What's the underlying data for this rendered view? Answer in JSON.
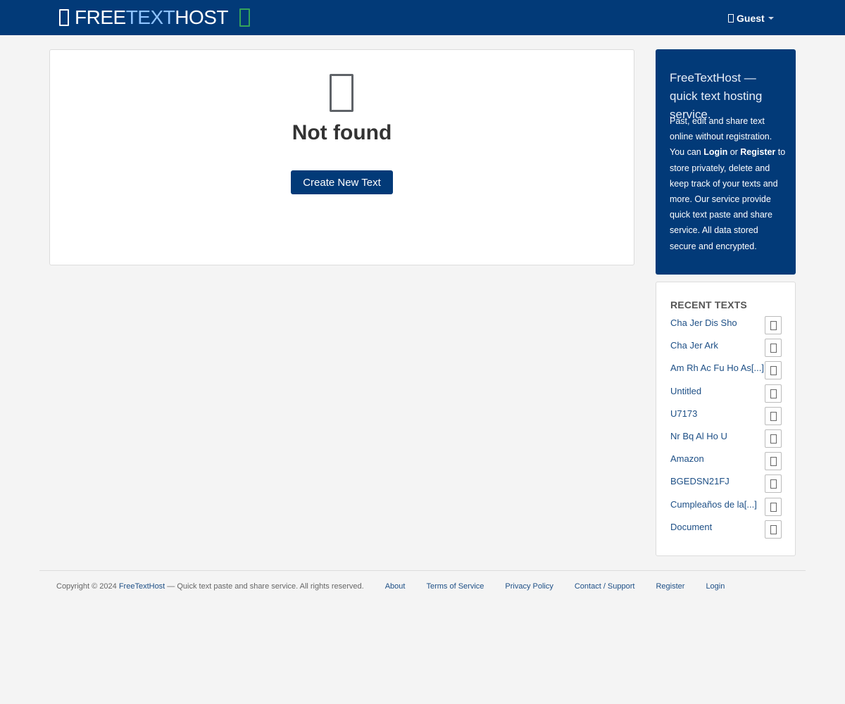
{
  "header": {
    "brand": {
      "part1": "FREE",
      "part2": "TEXT",
      "part3": "HOST"
    },
    "user_menu_label": "Guest"
  },
  "main": {
    "title": "Not found",
    "create_button": "Create New Text"
  },
  "promo": {
    "title": "FreeTextHost — quick text hosting service.",
    "body_pre": "Past, edit and share text online without registration. You can ",
    "login": "Login",
    "or": " or ",
    "register": "Register",
    "body_post": " to store privately, delete and keep track of your texts and more. Our service provide quick text paste and share service. All data stored secure and encrypted."
  },
  "recent": {
    "heading": "RECENT TEXTS",
    "items": [
      "Cha Jer Dis Sho",
      "Cha Jer Ark",
      "Am Rh Ac Fu Ho As[...]",
      "Untitled",
      "U7173",
      "Nr Bq Al Ho U",
      "Amazon",
      "BGEDSN21FJ",
      "Cumpleaños de la[...]",
      "Document"
    ]
  },
  "footer": {
    "copyright_pre": "Copyright © 2024 ",
    "site_name": "FreeTextHost",
    "copyright_post": " — Quick text paste and share service. All rights reserved.",
    "links": [
      "About",
      "Terms of Service",
      "Privacy Policy",
      "Contact / Support",
      "Register",
      "Login"
    ]
  },
  "icons": {
    "brand": "file-text-icon",
    "leaf": "leaf-icon",
    "user": "user-icon",
    "not_found": "file-icon",
    "copy": "copy-icon"
  },
  "colors": {
    "primary": "#023a78",
    "brand_accent": "#8ec3ff",
    "leaf": "#35a35a",
    "link": "#1d4f86",
    "background": "#f4f4f4"
  }
}
